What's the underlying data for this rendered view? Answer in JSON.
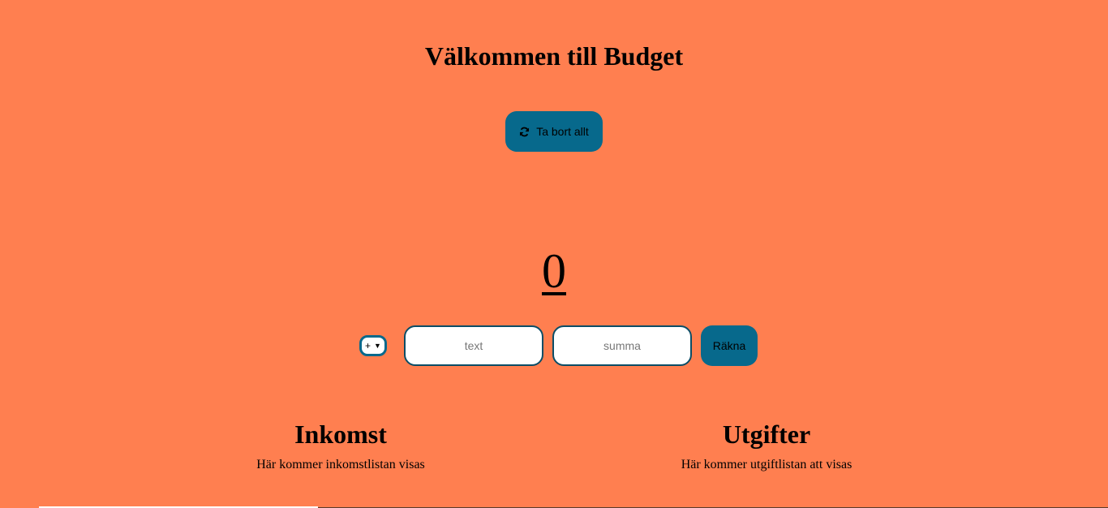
{
  "header": {
    "title": "Välkommen till Budget"
  },
  "actions": {
    "reset_label": "Ta bort allt",
    "reset_icon": "refresh-icon"
  },
  "balance": {
    "total": "0"
  },
  "form": {
    "type_value": "+",
    "text_placeholder": "text",
    "text_value": "",
    "sum_placeholder": "summa",
    "sum_value": "",
    "calc_label": "Räkna"
  },
  "income": {
    "heading": "Inkomst",
    "empty_text": "Här kommer inkomstlistan visas"
  },
  "expenses": {
    "heading": "Utgifter",
    "empty_text": "Här kommer utgiftlistan att visas"
  },
  "colors": {
    "background": "#ff7f50",
    "accent": "#07698c"
  }
}
